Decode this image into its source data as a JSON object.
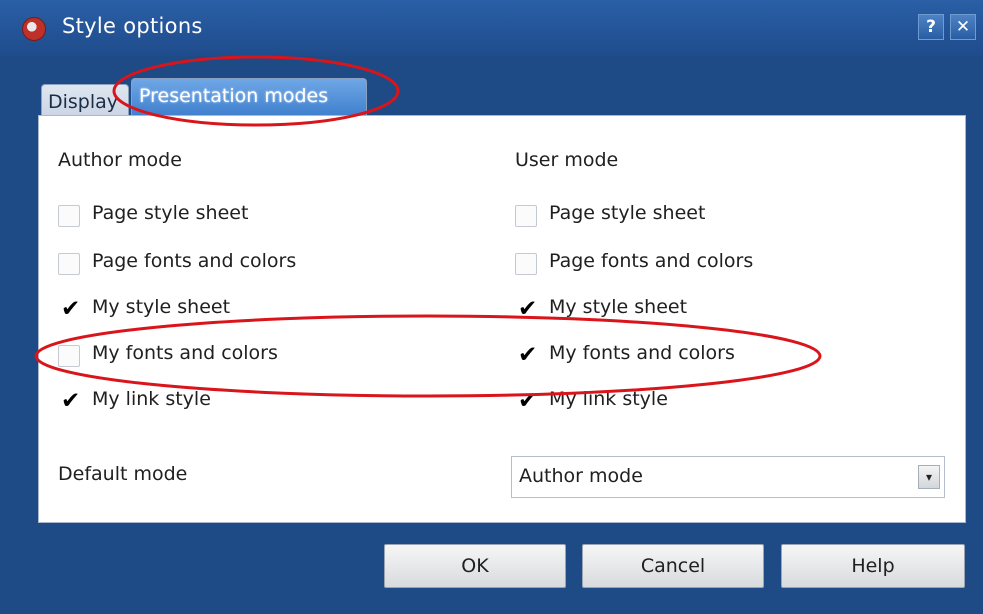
{
  "window": {
    "title": "Style options",
    "help_glyph": "?",
    "close_glyph": "✕",
    "icons": {
      "app": "opera-app-icon",
      "help": "help-icon",
      "close": "close-icon"
    }
  },
  "tabs": [
    {
      "label": "Display",
      "selected": false
    },
    {
      "label": "Presentation modes",
      "selected": true
    }
  ],
  "author_mode": {
    "heading": "Author mode",
    "options": [
      {
        "label": "Page style sheet",
        "checked": false
      },
      {
        "label": "Page fonts and colors",
        "checked": false
      },
      {
        "label": "My style sheet",
        "checked": true
      },
      {
        "label": "My fonts and colors",
        "checked": false
      },
      {
        "label": "My link style",
        "checked": true
      }
    ]
  },
  "user_mode": {
    "heading": "User mode",
    "options": [
      {
        "label": "Page style sheet",
        "checked": false
      },
      {
        "label": "Page fonts and colors",
        "checked": false
      },
      {
        "label": "My style sheet",
        "checked": true
      },
      {
        "label": "My fonts and colors",
        "checked": true
      },
      {
        "label": "My link style",
        "checked": true
      }
    ]
  },
  "default_mode": {
    "label": "Default mode",
    "value": "Author mode",
    "arrow_glyph": "▾"
  },
  "buttons": {
    "ok": "OK",
    "cancel": "Cancel",
    "help": "Help"
  },
  "check_glyph": "✔",
  "colors": {
    "annotation": "#d9151b",
    "titlebar": "#2a5fa6",
    "selected_tab": "#4f8ed8"
  }
}
